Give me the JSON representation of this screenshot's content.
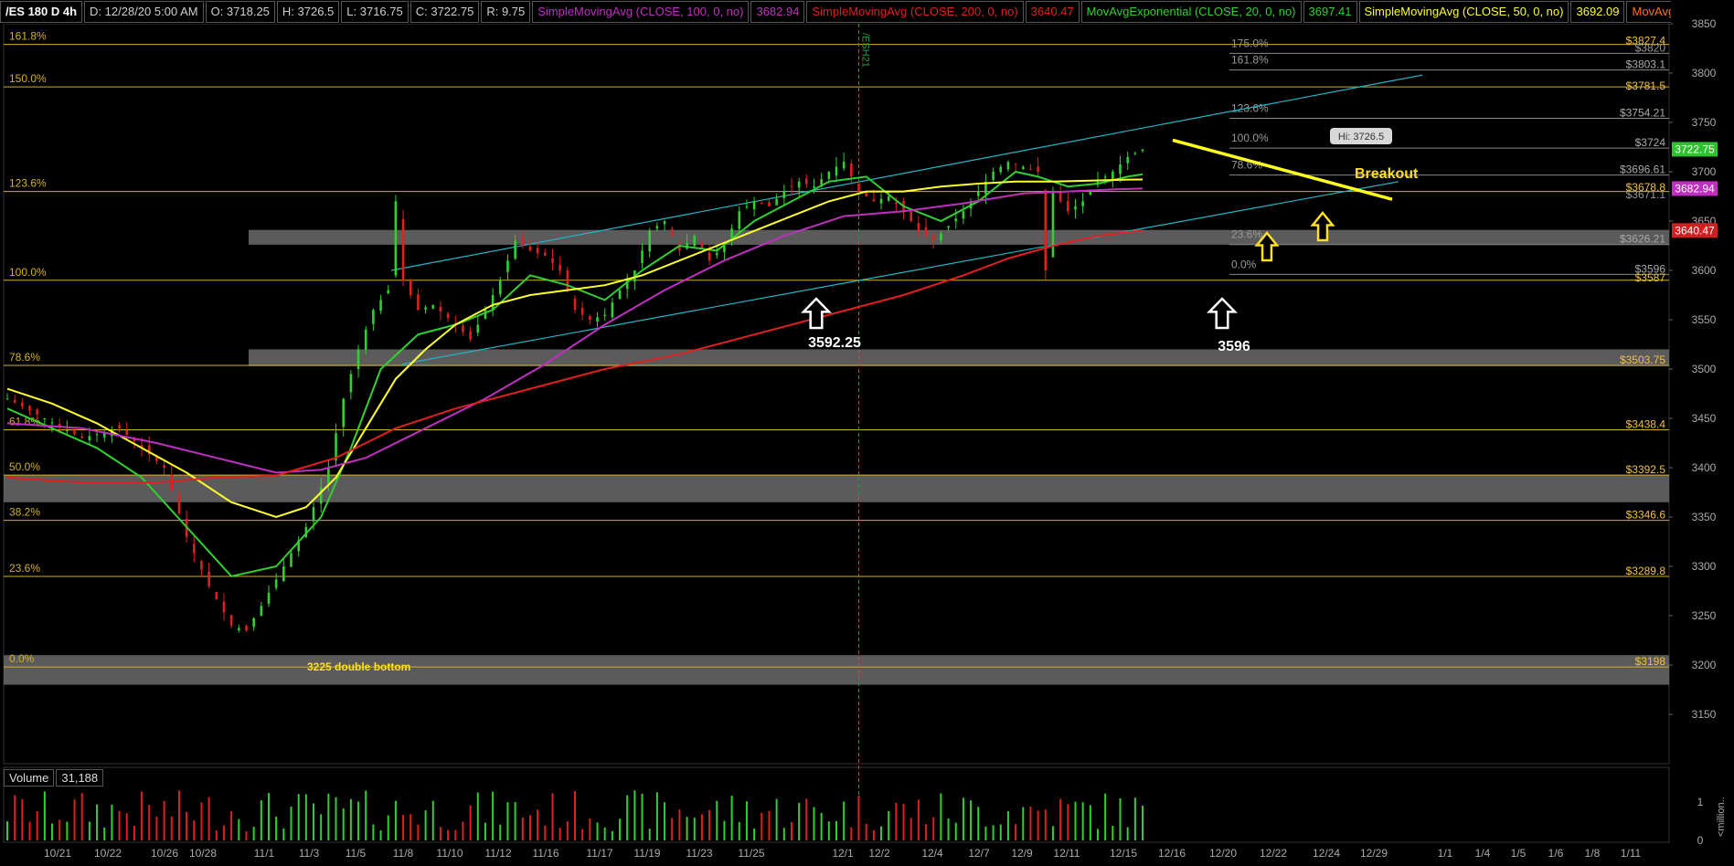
{
  "header": {
    "symbol": "/ES 180 D 4h",
    "date": "D: 12/28/20 5:00 AM",
    "open": "O: 3718.25",
    "high": "H: 3726.5",
    "low": "L: 3716.75",
    "close": "C: 3722.75",
    "range": "R: 9.75",
    "studies": [
      {
        "label": "SimpleMovingAvg (CLOSE, 100, 0, no)",
        "value": "3682.94",
        "color": "#c030c0"
      },
      {
        "label": "SimpleMovingAvg (CLOSE, 200, 0, no)",
        "value": "3640.47",
        "color": "#e02020"
      },
      {
        "label": "MovAvgExponential (CLOSE, 20, 0, no)",
        "value": "3697.41",
        "color": "#30d030"
      },
      {
        "label": "SimpleMovingAvg (CLOSE, 50, 0, no)",
        "value": "3692.09",
        "color": "#ffff30"
      },
      {
        "label": "MovAvgExponential ...",
        "value": "",
        "color": "#ff7020"
      }
    ]
  },
  "volume_header": {
    "label": "Volume",
    "value": "31,188"
  },
  "chart_data": {
    "type": "candlestick",
    "y_range": [
      3100,
      3850
    ],
    "y_ticks": [
      3150,
      3200,
      3250,
      3300,
      3350,
      3400,
      3450,
      3500,
      3550,
      3600,
      3650,
      3700,
      3750,
      3800,
      3850
    ],
    "x_labels": [
      "10/21",
      "10/22",
      "10/26",
      "10/28",
      "11/1",
      "11/3",
      "11/5",
      "11/8",
      "11/10",
      "11/12",
      "11/16",
      "11/17",
      "11/19",
      "11/23",
      "11/25",
      "12/1",
      "12/2",
      "12/4",
      "12/7",
      "12/9",
      "12/11",
      "12/15",
      "12/16",
      "12/20",
      "12/22",
      "12/24",
      "12/29",
      "1/1",
      "1/4",
      "1/5",
      "1/6",
      "1/8",
      "1/11"
    ],
    "price_path": [
      [
        0,
        3470
      ],
      [
        5,
        3450
      ],
      [
        10,
        3430
      ],
      [
        15,
        3440
      ],
      [
        18,
        3420
      ],
      [
        21,
        3400
      ],
      [
        24,
        3330
      ],
      [
        27,
        3280
      ],
      [
        30,
        3240
      ],
      [
        32,
        3235
      ],
      [
        34,
        3260
      ],
      [
        37,
        3300
      ],
      [
        40,
        3340
      ],
      [
        43,
        3400
      ],
      [
        45,
        3470
      ],
      [
        47,
        3520
      ],
      [
        49,
        3560
      ],
      [
        51,
        3580
      ],
      [
        52,
        3670
      ],
      [
        53,
        3590
      ],
      [
        55,
        3560
      ],
      [
        57,
        3565
      ],
      [
        60,
        3545
      ],
      [
        62,
        3530
      ],
      [
        64,
        3560
      ],
      [
        66,
        3590
      ],
      [
        68,
        3630
      ],
      [
        70,
        3620
      ],
      [
        72,
        3615
      ],
      [
        74,
        3600
      ],
      [
        76,
        3560
      ],
      [
        78,
        3550
      ],
      [
        80,
        3555
      ],
      [
        82,
        3580
      ],
      [
        84,
        3600
      ],
      [
        86,
        3640
      ],
      [
        88,
        3650
      ],
      [
        90,
        3620
      ],
      [
        92,
        3635
      ],
      [
        94,
        3610
      ],
      [
        96,
        3625
      ],
      [
        98,
        3660
      ],
      [
        100,
        3670
      ],
      [
        102,
        3665
      ],
      [
        104,
        3680
      ],
      [
        106,
        3690
      ],
      [
        108,
        3685
      ],
      [
        110,
        3700
      ],
      [
        112,
        3710
      ],
      [
        114,
        3680
      ],
      [
        116,
        3670
      ],
      [
        118,
        3675
      ],
      [
        120,
        3660
      ],
      [
        122,
        3640
      ],
      [
        124,
        3630
      ],
      [
        126,
        3645
      ],
      [
        128,
        3660
      ],
      [
        130,
        3680
      ],
      [
        132,
        3700
      ],
      [
        134,
        3710
      ],
      [
        136,
        3705
      ],
      [
        138,
        3700
      ],
      [
        139,
        3600
      ],
      [
        140,
        3680
      ],
      [
        142,
        3660
      ],
      [
        144,
        3670
      ],
      [
        146,
        3690
      ],
      [
        148,
        3700
      ],
      [
        150,
        3715
      ],
      [
        152,
        3722.75
      ]
    ],
    "last_index": 152,
    "moving_averages": [
      {
        "name": "MovAvgExponential 20",
        "color": "#30d030",
        "last": 3697.41,
        "points": [
          [
            0,
            3460
          ],
          [
            6,
            3440
          ],
          [
            12,
            3420
          ],
          [
            18,
            3390
          ],
          [
            24,
            3340
          ],
          [
            30,
            3290
          ],
          [
            36,
            3300
          ],
          [
            42,
            3350
          ],
          [
            46,
            3420
          ],
          [
            50,
            3500
          ],
          [
            55,
            3535
          ],
          [
            60,
            3545
          ],
          [
            65,
            3560
          ],
          [
            70,
            3595
          ],
          [
            75,
            3585
          ],
          [
            80,
            3570
          ],
          [
            85,
            3600
          ],
          [
            90,
            3625
          ],
          [
            95,
            3620
          ],
          [
            100,
            3650
          ],
          [
            105,
            3670
          ],
          [
            110,
            3690
          ],
          [
            115,
            3695
          ],
          [
            120,
            3665
          ],
          [
            125,
            3650
          ],
          [
            130,
            3670
          ],
          [
            135,
            3700
          ],
          [
            138,
            3695
          ],
          [
            142,
            3685
          ],
          [
            146,
            3688
          ],
          [
            150,
            3695
          ],
          [
            152,
            3697.41
          ]
        ]
      },
      {
        "name": "SimpleMovingAvg 50",
        "color": "#ffff30",
        "last": 3692.09,
        "points": [
          [
            0,
            3480
          ],
          [
            6,
            3465
          ],
          [
            12,
            3445
          ],
          [
            18,
            3420
          ],
          [
            24,
            3395
          ],
          [
            30,
            3365
          ],
          [
            36,
            3350
          ],
          [
            40,
            3360
          ],
          [
            44,
            3390
          ],
          [
            48,
            3440
          ],
          [
            52,
            3490
          ],
          [
            56,
            3520
          ],
          [
            60,
            3545
          ],
          [
            65,
            3565
          ],
          [
            70,
            3575
          ],
          [
            75,
            3580
          ],
          [
            80,
            3585
          ],
          [
            85,
            3595
          ],
          [
            90,
            3610
          ],
          [
            95,
            3625
          ],
          [
            100,
            3640
          ],
          [
            105,
            3655
          ],
          [
            110,
            3670
          ],
          [
            115,
            3680
          ],
          [
            120,
            3680
          ],
          [
            125,
            3685
          ],
          [
            130,
            3688
          ],
          [
            135,
            3690
          ],
          [
            140,
            3690
          ],
          [
            145,
            3691
          ],
          [
            150,
            3692
          ],
          [
            152,
            3692.09
          ]
        ]
      },
      {
        "name": "SimpleMovingAvg 100",
        "color": "#c030c0",
        "last": 3682.94,
        "points": [
          [
            0,
            3445
          ],
          [
            10,
            3440
          ],
          [
            20,
            3425
          ],
          [
            28,
            3410
          ],
          [
            36,
            3395
          ],
          [
            42,
            3398
          ],
          [
            48,
            3410
          ],
          [
            56,
            3440
          ],
          [
            64,
            3470
          ],
          [
            72,
            3505
          ],
          [
            80,
            3545
          ],
          [
            88,
            3580
          ],
          [
            96,
            3610
          ],
          [
            104,
            3635
          ],
          [
            112,
            3655
          ],
          [
            120,
            3660
          ],
          [
            128,
            3668
          ],
          [
            136,
            3678
          ],
          [
            142,
            3680
          ],
          [
            148,
            3682
          ],
          [
            152,
            3682.94
          ]
        ]
      },
      {
        "name": "SimpleMovingAvg 200",
        "color": "#e02020",
        "last": 3640.47,
        "points": [
          [
            0,
            3390
          ],
          [
            10,
            3385
          ],
          [
            20,
            3385
          ],
          [
            28,
            3390
          ],
          [
            36,
            3392
          ],
          [
            44,
            3410
          ],
          [
            52,
            3440
          ],
          [
            60,
            3460
          ],
          [
            70,
            3480
          ],
          [
            80,
            3500
          ],
          [
            90,
            3515
          ],
          [
            100,
            3535
          ],
          [
            110,
            3555
          ],
          [
            120,
            3575
          ],
          [
            128,
            3595
          ],
          [
            134,
            3612
          ],
          [
            140,
            3625
          ],
          [
            146,
            3635
          ],
          [
            152,
            3640.47
          ]
        ]
      }
    ],
    "fib_levels_left": [
      {
        "label": "161.8%",
        "value": 3829
      },
      {
        "label": "150.0%",
        "value": 3786
      },
      {
        "label": "123.6%",
        "value": 3680
      },
      {
        "label": "100.0%",
        "value": 3590
      },
      {
        "label": "78.6%",
        "value": 3503.75
      },
      {
        "label": "61.8%",
        "value": 3438.4
      },
      {
        "label": "50.0%",
        "value": 3392.5
      },
      {
        "label": "38.2%",
        "value": 3346.6
      },
      {
        "label": "23.6%",
        "value": 3289.8
      },
      {
        "label": "0.0%",
        "value": 3198
      }
    ],
    "right_level_labels": [
      {
        "label": "$3827.4",
        "value": 3827.4,
        "color": "#f0c040"
      },
      {
        "label": "$3820",
        "value": 3820,
        "color": "#999"
      },
      {
        "label": "$3803.1",
        "value": 3803.1,
        "color": "#aaa"
      },
      {
        "label": "$3781.5",
        "value": 3781.5,
        "color": "#f0c040"
      },
      {
        "label": "$3754.21",
        "value": 3754.21,
        "color": "#aaa"
      },
      {
        "label": "$3724",
        "value": 3724,
        "color": "#aaa"
      },
      {
        "label": "$3696.61",
        "value": 3696.61,
        "color": "#aaa"
      },
      {
        "label": "$3678.8",
        "value": 3678.8,
        "color": "#f0c040"
      },
      {
        "label": "$3671.1",
        "value": 3671.1,
        "color": "#999"
      },
      {
        "label": "$3626.21",
        "value": 3626.21,
        "color": "#aaa"
      },
      {
        "label": "$3596",
        "value": 3596,
        "color": "#aaa"
      },
      {
        "label": "$3587",
        "value": 3587,
        "color": "#f0c040"
      },
      {
        "label": "$3503.75",
        "value": 3503.75,
        "color": "#f0c040"
      },
      {
        "label": "$3438.4",
        "value": 3438.4,
        "color": "#f0c040"
      },
      {
        "label": "$3392.5",
        "value": 3392.5,
        "color": "#f0c040"
      },
      {
        "label": "$3346.6",
        "value": 3346.6,
        "color": "#f0c040"
      },
      {
        "label": "$3289.8",
        "value": 3289.8,
        "color": "#f0c040"
      },
      {
        "label": "$3198",
        "value": 3198,
        "color": "#f0c040"
      }
    ],
    "price_tags": [
      {
        "label": "3722.75",
        "value": 3722.75,
        "color": "#30c030"
      },
      {
        "label": "3682.94",
        "value": 3682.94,
        "color": "#c030c0"
      },
      {
        "label": "3640.47",
        "value": 3640.47,
        "color": "#d02020"
      }
    ],
    "zones": [
      {
        "from": 3626,
        "to": 3641
      },
      {
        "from": 3503,
        "to": 3520
      },
      {
        "from": 3365,
        "to": 3393
      },
      {
        "from": 3180,
        "to": 3210
      }
    ],
    "upper_fib_labels": [
      {
        "label": "175.0%",
        "value": 3820
      },
      {
        "label": "161.8%",
        "value": 3803.1
      },
      {
        "label": "123.6%",
        "value": 3754.21
      },
      {
        "label": "100.0%",
        "value": 3724
      },
      {
        "label": "78.6%",
        "value": 3696.61
      },
      {
        "label": "23.6%",
        "value": 3626.21
      },
      {
        "label": "0.0%",
        "value": 3596
      }
    ],
    "annotations": {
      "low1": "3592.25",
      "low2": "3596",
      "breakout": "Breakout",
      "double_bottom": "3225 double bottom",
      "hi": "Hi: 3726.5",
      "expiry": "/ESH21"
    },
    "volume_axis": [
      "1",
      "0",
      "<million.."
    ]
  }
}
